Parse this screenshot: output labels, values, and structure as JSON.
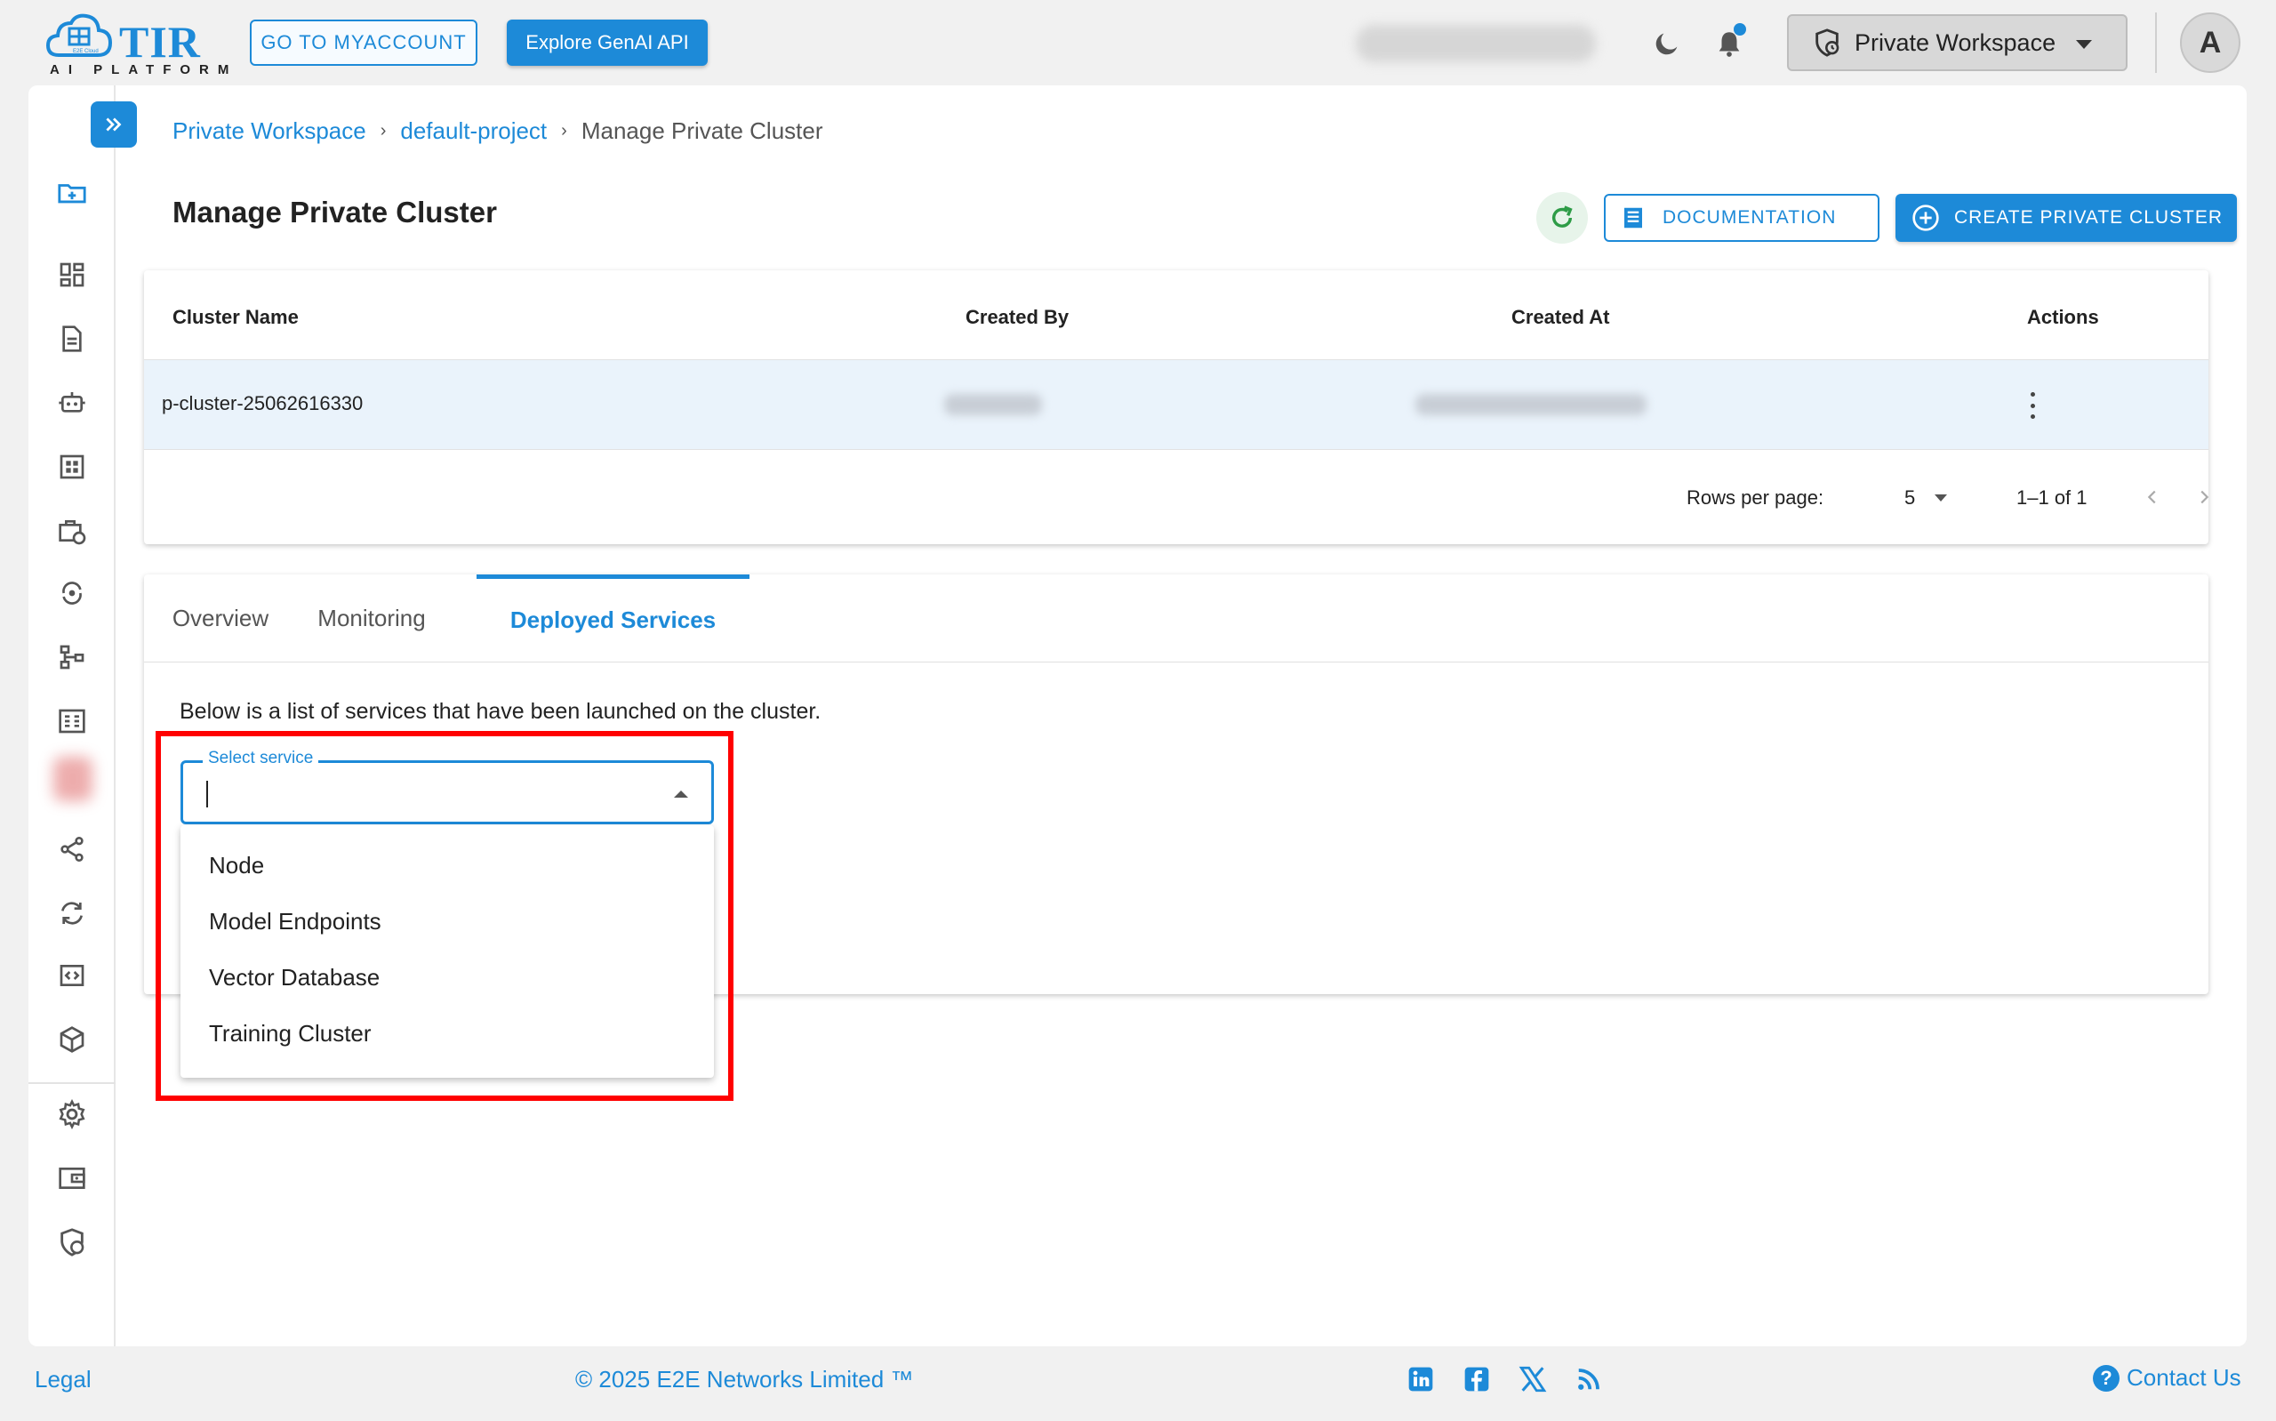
{
  "header": {
    "logo_text": "TIR",
    "logo_subtext": "AI PLATFORM",
    "logo_badge": "E2E Cloud",
    "myaccount_label": "GO TO MYACCOUNT",
    "genai_label": "Explore GenAI API",
    "workspace_label": "Private Workspace",
    "avatar_initial": "A"
  },
  "breadcrumb": {
    "workspace": "Private Workspace",
    "project": "default-project",
    "current": "Manage Private Cluster"
  },
  "page": {
    "title": "Manage Private Cluster",
    "documentation_label": "DOCUMENTATION",
    "create_label": "CREATE PRIVATE CLUSTER"
  },
  "table": {
    "columns": [
      "Cluster Name",
      "Created By",
      "Created At",
      "Actions"
    ],
    "rows": [
      {
        "cluster_name": "p-cluster-25062616330"
      }
    ],
    "rows_per_page_label": "Rows per page:",
    "rows_per_page_value": "5",
    "range_label": "1–1 of 1"
  },
  "tabs": [
    {
      "label": "Overview",
      "active": false
    },
    {
      "label": "Monitoring",
      "active": false
    },
    {
      "label": "Deployed Services",
      "active": true
    }
  ],
  "deployed": {
    "description": "Below is a list of services that have been launched on the cluster.",
    "select_label": "Select service",
    "select_value": "",
    "options": [
      "Node",
      "Model Endpoints",
      "Vector Database",
      "Training Cluster"
    ]
  },
  "footer": {
    "legal": "Legal",
    "copyright": "© 2025 E2E Networks Limited ™",
    "contact": "Contact Us",
    "social_icons": [
      "linkedin-icon",
      "facebook-icon",
      "x-icon",
      "rss-icon"
    ]
  },
  "colors": {
    "accent": "#1d8ad8",
    "highlight": "#ff0000",
    "row_selected": "#eaf3fb"
  }
}
